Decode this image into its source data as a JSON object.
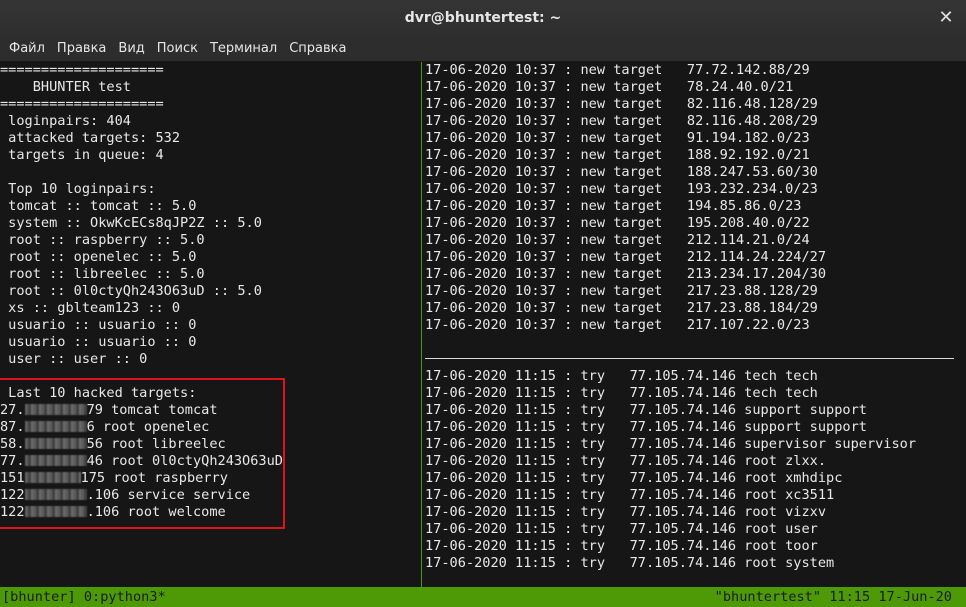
{
  "window": {
    "title": "dvr@bhuntertest: ~",
    "close_glyph": "✕"
  },
  "menu": [
    "Файл",
    "Правка",
    "Вид",
    "Поиск",
    "Терминал",
    "Справка"
  ],
  "left_pane": {
    "lines": [
      "====================",
      "    BHUNTER test",
      "====================",
      " loginpairs: 404",
      " attacked targets: 532",
      " targets in queue: 4",
      "",
      " Top 10 loginpairs:",
      " tomcat :: tomcat :: 5.0",
      " system :: OkwKcECs8qJP2Z :: 5.0",
      " root :: raspberry :: 5.0",
      " root :: openelec :: 5.0",
      " root :: libreelec :: 5.0",
      " root :: 0l0ctyQh243O63uD :: 5.0",
      " xs :: gblteam123 :: 0",
      " usuario :: usuario :: 0",
      " usuario :: usuario :: 0",
      " user :: user :: 0",
      "",
      " Last 10 hacked targets:"
    ],
    "hacked": [
      {
        "pre": "27.",
        "post": "79 tomcat tomcat"
      },
      {
        "pre": "87.",
        "post": "6 root openelec"
      },
      {
        "pre": "58.",
        "post": "56 root libreelec"
      },
      {
        "pre": "77.",
        "post": "46 root 0l0ctyQh243O63uD"
      },
      {
        "pre": "151",
        "post": "175 root raspberry"
      },
      {
        "pre": "122",
        "post": ".106 service service"
      },
      {
        "pre": "122",
        "post": ".106 root welcome"
      }
    ]
  },
  "right_top": [
    "17-06-2020 10:37 : new target   77.72.142.88/29",
    "17-06-2020 10:37 : new target   78.24.40.0/21",
    "17-06-2020 10:37 : new target   82.116.48.128/29",
    "17-06-2020 10:37 : new target   82.116.48.208/29",
    "17-06-2020 10:37 : new target   91.194.182.0/23",
    "17-06-2020 10:37 : new target   188.92.192.0/21",
    "17-06-2020 10:37 : new target   188.247.53.60/30",
    "17-06-2020 10:37 : new target   193.232.234.0/23",
    "17-06-2020 10:37 : new target   194.85.86.0/23",
    "17-06-2020 10:37 : new target   195.208.40.0/22",
    "17-06-2020 10:37 : new target   212.114.21.0/24",
    "17-06-2020 10:37 : new target   212.114.24.224/27",
    "17-06-2020 10:37 : new target   213.234.17.204/30",
    "17-06-2020 10:37 : new target   217.23.88.128/29",
    "17-06-2020 10:37 : new target   217.23.88.184/29",
    "17-06-2020 10:37 : new target   217.107.22.0/23"
  ],
  "right_bottom": [
    "17-06-2020 11:15 : try   77.105.74.146 tech tech",
    "17-06-2020 11:15 : try   77.105.74.146 tech tech",
    "17-06-2020 11:15 : try   77.105.74.146 support support",
    "17-06-2020 11:15 : try   77.105.74.146 support support",
    "17-06-2020 11:15 : try   77.105.74.146 supervisor supervisor",
    "17-06-2020 11:15 : try   77.105.74.146 root zlxx.",
    "17-06-2020 11:15 : try   77.105.74.146 root xmhdipc",
    "17-06-2020 11:15 : try   77.105.74.146 root xc3511",
    "17-06-2020 11:15 : try   77.105.74.146 root vizxv",
    "17-06-2020 11:15 : try   77.105.74.146 root user",
    "17-06-2020 11:15 : try   77.105.74.146 root toor",
    "17-06-2020 11:15 : try   77.105.74.146 root system"
  ],
  "status": {
    "left": "[bhunter] 0:python3*",
    "right": "\"bhuntertest\" 11:15 17-Jun-20"
  },
  "colors": {
    "status_bg": "#4e9a06",
    "highlight_border": "#e0131a"
  }
}
